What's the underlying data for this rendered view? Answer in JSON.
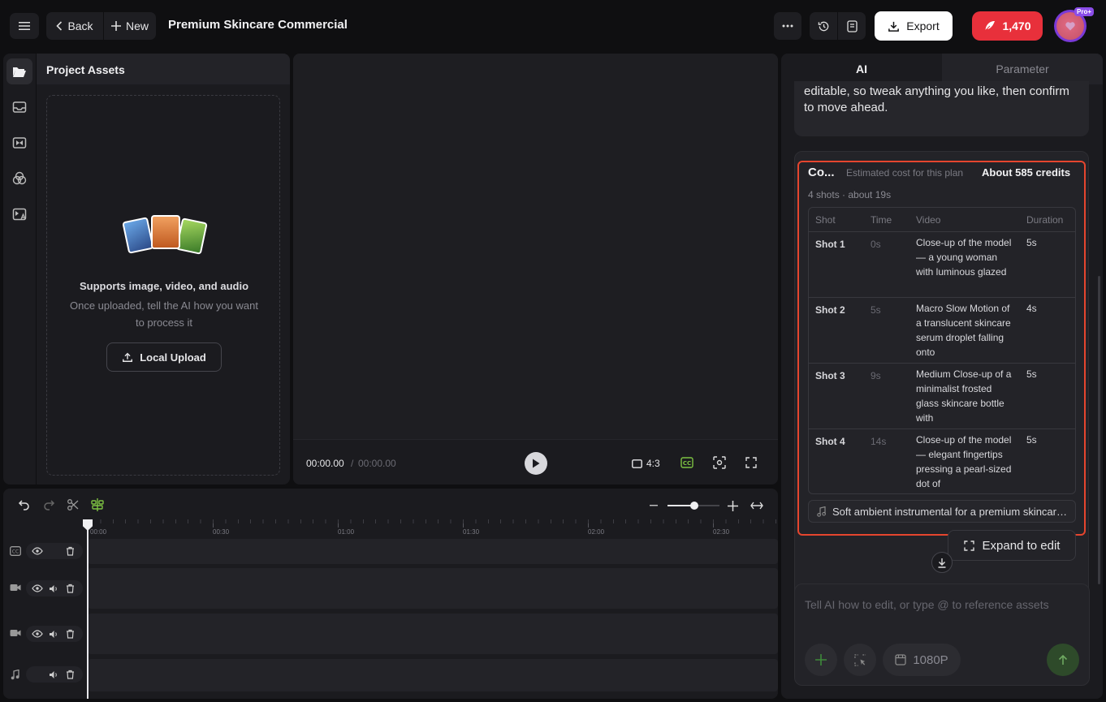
{
  "header": {
    "back_label": "Back",
    "new_label": "New",
    "project_title": "Premium Skincare Commercial",
    "export_label": "Export",
    "credits": "1,470",
    "pro_badge": "Pro+"
  },
  "assets": {
    "title": "Project Assets",
    "supports_text": "Supports image, video, and audio",
    "sub_text": "Once uploaded, tell the AI how you want to process it",
    "upload_label": "Local Upload"
  },
  "player": {
    "current_time": "00:00.00",
    "separator": "/",
    "total_time": "00:00.00",
    "aspect_ratio": "4:3"
  },
  "timeline": {
    "ticks": [
      "00:00",
      "00:30",
      "01:00",
      "01:30",
      "02:00",
      "02:30"
    ]
  },
  "right_panel": {
    "tabs": [
      {
        "label": "AI",
        "active": true
      },
      {
        "label": "Parameter",
        "active": false
      }
    ],
    "message": "your project below is ready. Everything below is editable, so tweak anything you like, then confirm to move ahead.",
    "plan": {
      "name": "Co...",
      "estimate_label": "Estimated cost for this plan",
      "credits_text": "About 585 credits",
      "meta": "4 shots · about 19s",
      "columns": [
        "Shot",
        "Time",
        "Video",
        "Duration"
      ],
      "shots": [
        {
          "shot": "Shot 1",
          "time": "0s",
          "video": "Close-up of the model — a young woman with luminous glazed",
          "duration": "5s"
        },
        {
          "shot": "Shot 2",
          "time": "5s",
          "video": "Macro Slow Motion of a translucent skincare serum droplet falling onto",
          "duration": "4s"
        },
        {
          "shot": "Shot 3",
          "time": "9s",
          "video": "Medium Close-up of a minimalist frosted glass skincare bottle with",
          "duration": "5s"
        },
        {
          "shot": "Shot 4",
          "time": "14s",
          "video": "Close-up of the model — elegant fingertips pressing a pearl-sized dot of",
          "duration": "5s"
        }
      ],
      "music": "Soft ambient instrumental for a premium skincare commercial",
      "expand_label": "Expand to edit"
    },
    "input": {
      "placeholder": "Tell AI how to edit, or type @ to reference assets",
      "resolution": "1080P"
    }
  },
  "colors": {
    "accent_red": "#e8303b",
    "highlight_border": "#e5452e",
    "cc_green": "#7dc242"
  }
}
